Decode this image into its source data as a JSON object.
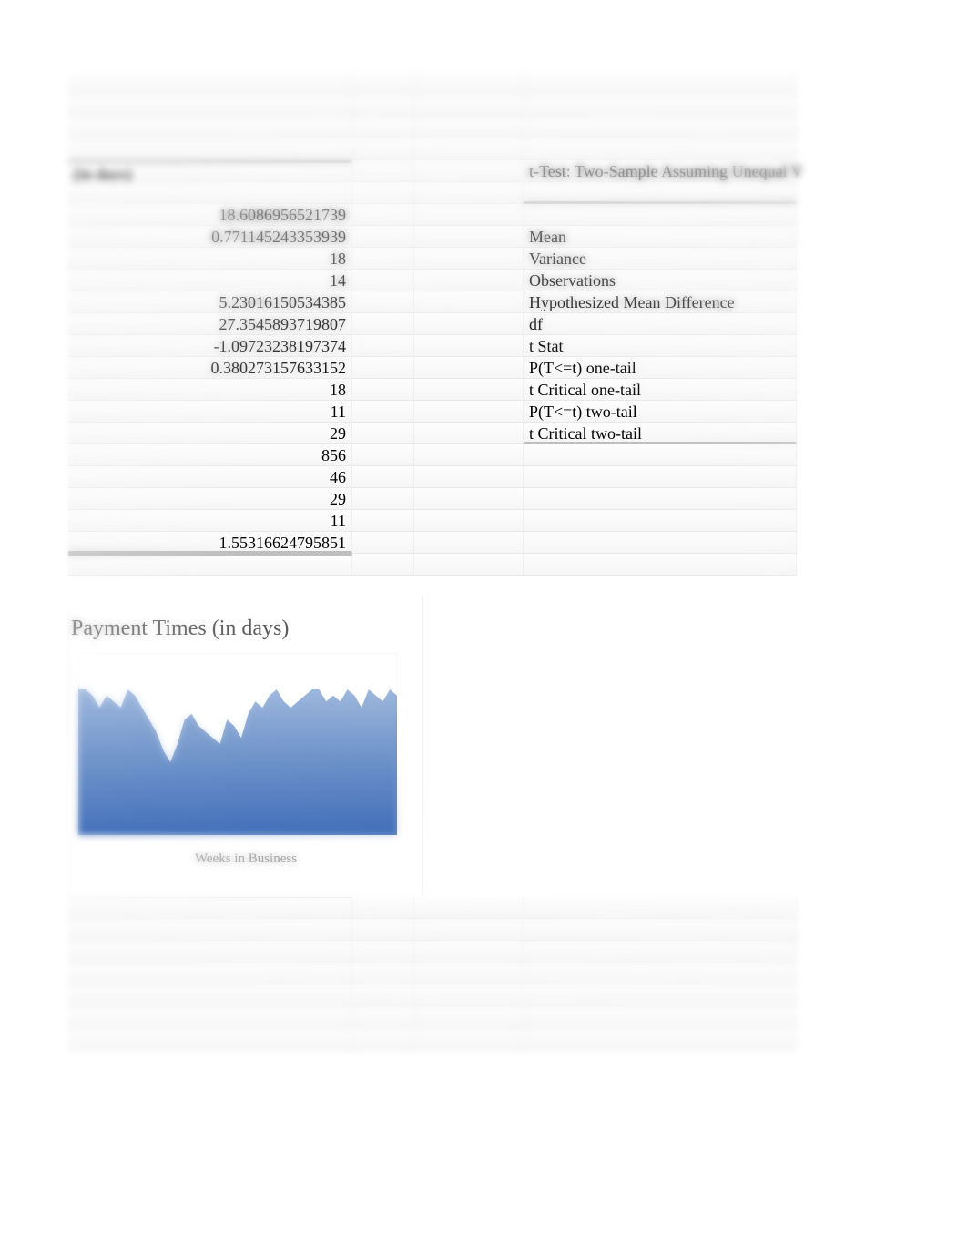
{
  "leftHeader": "(in days)",
  "rightHeader": "t-Test: Two-Sample Assuming Unequal V",
  "leftValues": [
    "18.6086956521739",
    "0.771145243353939",
    "18",
    "14",
    "5.23016150534385",
    "27.3545893719807",
    "-1.09723238197374",
    "0.380273157633152",
    "18",
    "11",
    "29",
    "856",
    "46",
    "29",
    "11",
    "1.55316624795851"
  ],
  "rightLabels": [
    "Mean",
    "Variance",
    "Observations",
    "Hypothesized Mean Difference",
    "df",
    "t Stat",
    "P(T<=t) one-tail",
    "t Critical one-tail",
    "P(T<=t) two-tail",
    "t Critical two-tail"
  ],
  "chart_data": {
    "type": "area",
    "title": "Payment Times (in days)",
    "xlabel": "Weeks in Business",
    "ylabel": "",
    "ylim": [
      0,
      30
    ],
    "x": [
      1,
      2,
      3,
      4,
      5,
      6,
      7,
      8,
      9,
      10,
      11,
      12,
      13,
      14,
      15,
      16,
      17,
      18,
      19,
      20,
      21,
      22,
      23,
      24,
      25,
      26,
      27,
      28,
      29,
      30,
      31,
      32,
      33,
      34,
      35,
      36,
      37,
      38,
      39,
      40,
      41,
      42,
      43,
      44,
      45,
      46
    ],
    "values": [
      24,
      24,
      23,
      21,
      23,
      22,
      21,
      24,
      23,
      21,
      19,
      17,
      14,
      12,
      15,
      19,
      20,
      18,
      17,
      16,
      15,
      19,
      18,
      16,
      20,
      22,
      21,
      23,
      24,
      22,
      21,
      22,
      23,
      24,
      24,
      22,
      23,
      22,
      24,
      23,
      21,
      24,
      23,
      22,
      24,
      23
    ]
  }
}
